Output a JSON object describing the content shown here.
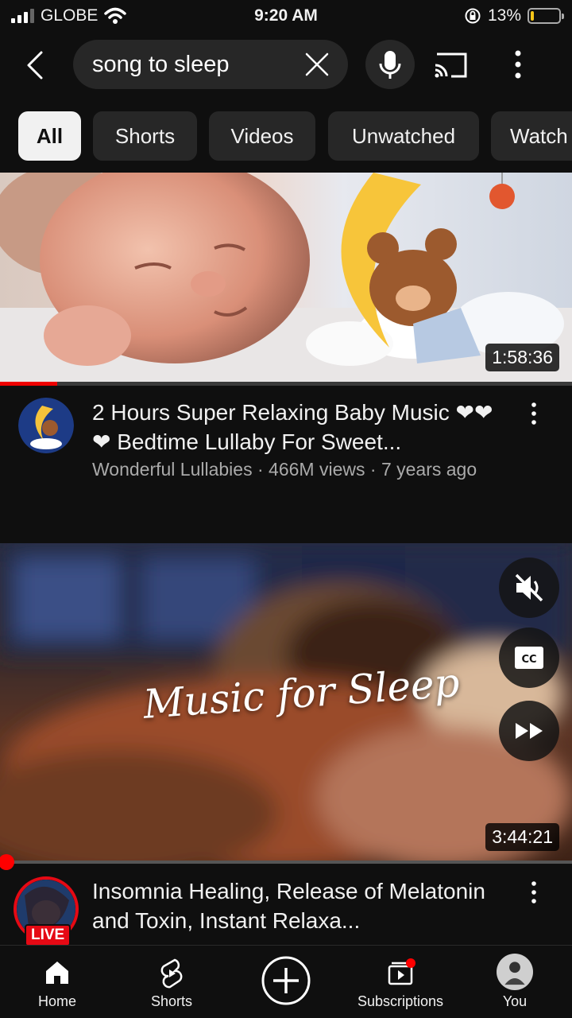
{
  "status_bar": {
    "carrier": "GLOBE",
    "time": "9:20 AM",
    "battery_percent": "13%",
    "battery_level": 0.13
  },
  "search": {
    "query": "song to sleep"
  },
  "chips": [
    {
      "label": "All",
      "active": true
    },
    {
      "label": "Shorts"
    },
    {
      "label": "Videos"
    },
    {
      "label": "Unwatched"
    },
    {
      "label": "Watch"
    }
  ],
  "videos": [
    {
      "duration": "1:58:36",
      "watched_fraction": 0.1,
      "title": "2 Hours Super Relaxing Baby Music ❤❤❤ Bedtime Lullaby For Sweet...",
      "channel": "Wonderful Lullabies",
      "views": "466M views",
      "age": "7 years ago"
    },
    {
      "duration": "3:44:21",
      "overlay_text": "Music for Sleep",
      "title": "Insomnia Healing, Release of Melatonin and Toxin, Instant Relaxa...",
      "live_badge": "LIVE"
    }
  ],
  "bottom_nav": {
    "home": "Home",
    "shorts": "Shorts",
    "subscriptions": "Subscriptions",
    "you": "You"
  },
  "colors": {
    "background": "#0f0f0f",
    "chip_bg": "#272727",
    "accent_red": "#ff0000"
  }
}
